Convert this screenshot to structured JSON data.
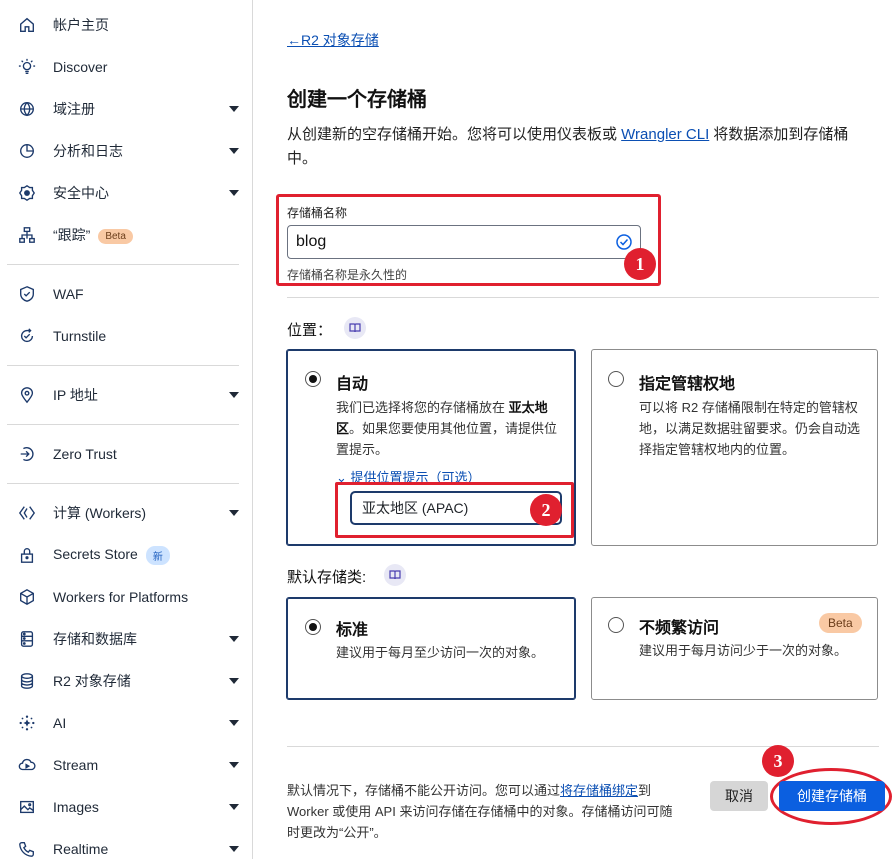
{
  "sidebar": {
    "items": [
      {
        "label": "帐户主页",
        "icon": "home-icon"
      },
      {
        "label": "Discover",
        "icon": "lightbulb-icon"
      },
      {
        "label": "域注册",
        "icon": "globe-icon",
        "expandable": true
      },
      {
        "label": "分析和日志",
        "icon": "chart-icon",
        "expandable": true
      },
      {
        "label": "安全中心",
        "icon": "security-center-icon",
        "expandable": true
      },
      {
        "label": "“跟踪”",
        "icon": "trace-icon",
        "badge": "Beta"
      },
      {
        "label": "WAF",
        "icon": "shield-icon"
      },
      {
        "label": "Turnstile",
        "icon": "turnstile-icon"
      },
      {
        "label": "IP 地址",
        "icon": "location-pin-icon",
        "expandable": true
      },
      {
        "label": "Zero Trust",
        "icon": "zero-trust-icon"
      },
      {
        "label": "计算 (Workers)",
        "icon": "workers-icon",
        "expandable": true
      },
      {
        "label": "Secrets Store",
        "icon": "lock-icon",
        "badge": "新"
      },
      {
        "label": "Workers for Platforms",
        "icon": "cube-icon"
      },
      {
        "label": "存储和数据库",
        "icon": "storage-icon",
        "expandable": true
      },
      {
        "label": "R2 对象存储",
        "icon": "database-icon",
        "expandable": true
      },
      {
        "label": "AI",
        "icon": "ai-sparkle-icon",
        "expandable": true
      },
      {
        "label": "Stream",
        "icon": "cloud-icon",
        "expandable": true
      },
      {
        "label": "Images",
        "icon": "image-icon",
        "expandable": true
      },
      {
        "label": "Realtime",
        "icon": "phone-icon",
        "expandable": true
      }
    ]
  },
  "main": {
    "back_link": "←R2 对象存储",
    "title": "创建一个存储桶",
    "intro_before": "从创建新的空存储桶开始。您将可以使用仪表板或 ",
    "intro_link": "Wrangler CLI",
    "intro_after": " 将数据添加到存储桶中。",
    "name_field": {
      "label": "存储桶名称",
      "value": "blog",
      "help": "存储桶名称是永久性的"
    },
    "location": {
      "title": "位置：",
      "auto": {
        "title": "自动",
        "desc_before": "我们已选择将您的存储桶放在 ",
        "desc_bold": "亚太地区",
        "desc_after": "。如果您要使用其他位置，请提供位置提示。",
        "hint_link": "提供位置提示（可选）",
        "hint_value": "亚太地区 (APAC)"
      },
      "jurisdiction": {
        "title": "指定管辖权地",
        "desc": "可以将 R2 存储桶限制在特定的管辖权地，以满足数据驻留要求。仍会自动选择指定管辖权地内的位置。"
      }
    },
    "storage_class": {
      "title": "默认存储类:",
      "standard": {
        "title": "标准",
        "desc": "建议用于每月至少访问一次的对象。"
      },
      "infrequent": {
        "title": "不频繁访问",
        "badge": "Beta",
        "desc": "建议用于每月访问少于一次的对象。"
      }
    },
    "footer": {
      "text_before": "默认情况下，存储桶不能公开访问。您可以通过",
      "text_link": "将存储桶绑定",
      "text_after": "到 Worker 或使用 API 来访问存储在存储桶中的对象。存储桶访问可随时更改为“公开”。",
      "cancel_label": "取消",
      "create_label": "创建存储桶"
    },
    "annotations": [
      "1",
      "2",
      "3"
    ]
  },
  "colors": {
    "accent": "#0b5fe0",
    "annotation": "#e0202f",
    "nav_icon": "#1d3a6b"
  }
}
